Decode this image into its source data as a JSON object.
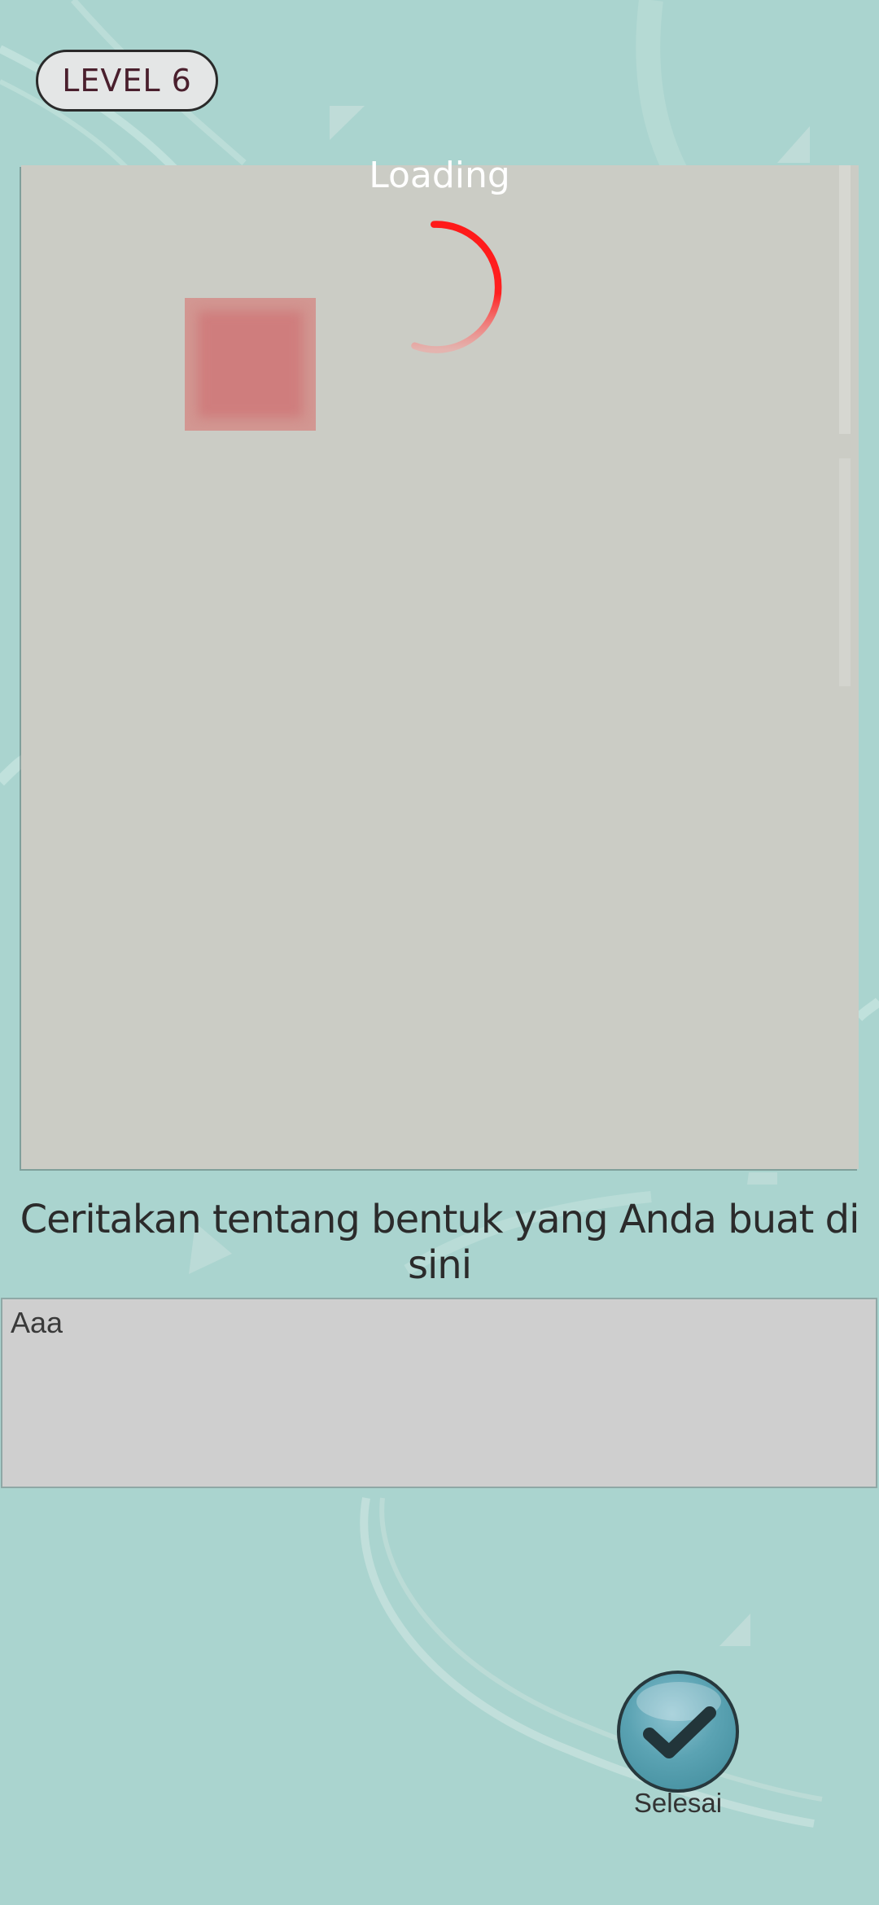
{
  "header": {
    "level_label": "LEVEL 6"
  },
  "canvas": {
    "loading_text": "Loading"
  },
  "prompt": {
    "text": "Ceritakan tentang bentuk yang Anda buat di sini"
  },
  "answer": {
    "value": "Aaa"
  },
  "done_button": {
    "label": "Selesai",
    "icon": "checkmark-icon"
  },
  "colors": {
    "background": "#aad4cf",
    "canvas": "#cbccc5",
    "spinner": "#ff1a1a",
    "shape": "#cf7d7d",
    "button": "#5ba3b3"
  }
}
